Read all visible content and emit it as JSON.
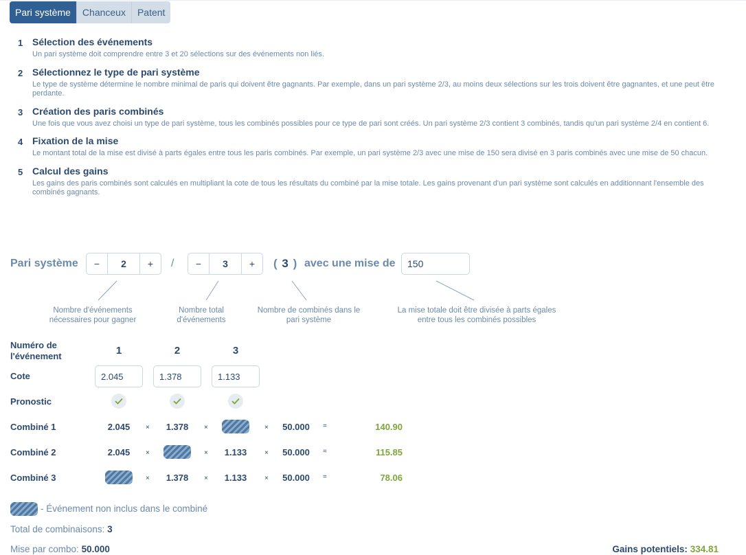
{
  "tabs": [
    {
      "label": "Pari système",
      "active": true
    },
    {
      "label": "Chanceux",
      "active": false
    },
    {
      "label": "Patent",
      "active": false
    }
  ],
  "steps": [
    {
      "num": "1",
      "title": "Sélection des événements",
      "desc": "Un pari système doit comprendre entre 3 et 20 sélections sur des événements non liés."
    },
    {
      "num": "2",
      "title": "Sélectionnez le type de pari système",
      "desc": "Le type de système détermine le nombre minimal de paris qui doivent être gagnants. Par exemple, dans un pari système 2/3, au moins deux sélections sur les trois doivent être gagnantes, et une peut être perdante."
    },
    {
      "num": "3",
      "title": "Création des paris combinés",
      "desc": "Une fois que vous avez choisi un type de pari système, tous les combinés possibles pour ce type de pari sont créés. Un pari système 2/3 contient 3 combinés, tandis qu'un pari système 2/4 en contient 6."
    },
    {
      "num": "4",
      "title": "Fixation de la mise",
      "desc": "Le montant total de la mise est divisé à parts égales entre tous les paris combinés. Par exemple, un pari système 2/3 avec une mise de 150 sera divisé en 3 paris combinés avec une mise de 50 chacun."
    },
    {
      "num": "5",
      "title": "Calcul des gains",
      "desc": "Les gains des paris combinés sont calculés en multipliant la cote de tous les résultats du combiné par la mise totale. Les gains provenant d'un pari système sont calculés en additionnant l'ensemble des combinés gagnants."
    }
  ],
  "system": {
    "label": "Pari système",
    "minus": "−",
    "plus": "+",
    "min_wins": "2",
    "slash": "/",
    "total_events": "3",
    "combos_open": "(",
    "combos_value": "3",
    "combos_close": ")",
    "stake_label": "avec une mise de",
    "stake_value": "150"
  },
  "hints": {
    "min_wins": "Nombre d'événements nécessaires pour gagner",
    "total": "Nombre total d'événements",
    "combos": "Nombre de combinés dans le pari système",
    "stake": "La mise totale doit être divisée à parts égales entre tous les combinés possibles"
  },
  "table": {
    "event_number_label": "Numéro de l'événement",
    "odds_label": "Cote",
    "prediction_label": "Pronostic",
    "event_numbers": [
      "1",
      "2",
      "3"
    ],
    "odds": [
      "2.045",
      "1.378",
      "1.133"
    ],
    "combos": [
      {
        "label": "Combiné 1",
        "cells": [
          "2.045",
          "1.378",
          null
        ],
        "stake": "50.000",
        "result": "140.90"
      },
      {
        "label": "Combiné 2",
        "cells": [
          "2.045",
          null,
          "1.133"
        ],
        "stake": "50.000",
        "result": "115.85"
      },
      {
        "label": "Combiné 3",
        "cells": [
          null,
          "1.378",
          "1.133"
        ],
        "stake": "50.000",
        "result": "78.06"
      }
    ],
    "times": "×",
    "equals": "="
  },
  "legend": "- Événement non inclus dans le combiné",
  "totals": {
    "combinations_label": "Total de combinaisons:",
    "combinations_value": "3",
    "stake_per_combo_label": "Mise par combo:",
    "stake_per_combo_value": "50.000",
    "potential_gains_label": "Gains potentiels:",
    "potential_gains_value": "334.81"
  },
  "colors": {
    "accent": "#2f5f93",
    "text": "#2c4a6e",
    "muted": "#6b8aab",
    "positive": "#7ca63b"
  }
}
